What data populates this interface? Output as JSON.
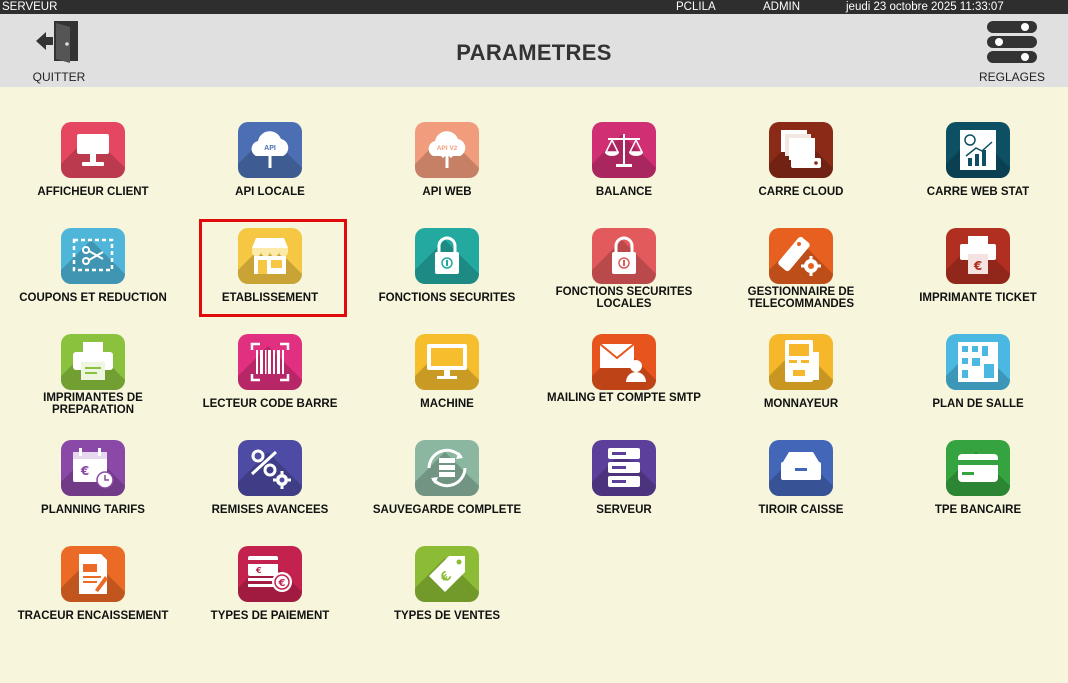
{
  "statusbar": {
    "left": "SERVEUR",
    "computer": "PCLILA",
    "user": "ADMIN",
    "datetime": "jeudi 23 octobre 2025   11:33:07"
  },
  "header": {
    "title": "PARAMETRES",
    "quit_label": "QUITTER",
    "settings_label": "REGLAGES"
  },
  "selected_item": "ETABLISSEMENT",
  "tiles": [
    {
      "label": "AFFICHEUR CLIENT",
      "color": "#e4475f",
      "icon": "customer-display-icon"
    },
    {
      "label": "API LOCALE",
      "color": "#4c6fb3",
      "icon": "cloud-upload-icon",
      "badge": "API"
    },
    {
      "label": "API WEB",
      "color": "#f19d7d",
      "icon": "cloud-upload-icon",
      "badge": "API V2"
    },
    {
      "label": "BALANCE",
      "color": "#d02f73",
      "icon": "scale-icon"
    },
    {
      "label": "CARRE CLOUD",
      "color": "#8a2a17",
      "icon": "server-stack-icon"
    },
    {
      "label": "CARRE WEB STAT",
      "color": "#0d4f63",
      "icon": "web-stat-icon"
    },
    {
      "label": "COUPONS ET REDUCTION",
      "color": "#4fb6da",
      "icon": "coupon-scissors-icon"
    },
    {
      "label": "ETABLISSEMENT",
      "color": "#f6c742",
      "icon": "shop-icon"
    },
    {
      "label": "FONCTIONS SECURITES",
      "color": "#24a9a0",
      "icon": "padlock-icon"
    },
    {
      "label": "FONCTIONS SECURITES LOCALES",
      "color": "#e35a5d",
      "icon": "padlock-icon"
    },
    {
      "label": "GESTIONNAIRE DE TELECOMMANDES",
      "color": "#e8601f",
      "icon": "remote-control-icon"
    },
    {
      "label": "IMPRIMANTE TICKET",
      "color": "#b12f20",
      "icon": "ticket-printer-icon"
    },
    {
      "label": "IMPRIMANTES DE PREPARATION",
      "color": "#8ac23e",
      "icon": "printer-icon"
    },
    {
      "label": "LECTEUR CODE BARRE",
      "color": "#e0307f",
      "icon": "barcode-icon"
    },
    {
      "label": "MACHINE",
      "color": "#f6be2d",
      "icon": "monitor-icon"
    },
    {
      "label": "MAILING ET COMPTE SMTP",
      "color": "#e8541e",
      "icon": "mail-user-icon"
    },
    {
      "label": "MONNAYEUR",
      "color": "#f6b72a",
      "icon": "cash-machine-icon"
    },
    {
      "label": "PLAN DE SALLE",
      "color": "#4ab8e0",
      "icon": "floor-plan-icon"
    },
    {
      "label": "PLANNING TARIFS",
      "color": "#8a49a6",
      "icon": "calendar-euro-icon"
    },
    {
      "label": "REMISES AVANCEES",
      "color": "#4d4ba4",
      "icon": "percent-gear-icon"
    },
    {
      "label": "SAUVEGARDE COMPLETE",
      "color": "#8bb6a0",
      "icon": "backup-icon"
    },
    {
      "label": "SERVEUR",
      "color": "#5c3f9a",
      "icon": "server-icon"
    },
    {
      "label": "TIROIR CAISSE",
      "color": "#4466b8",
      "icon": "cash-drawer-icon"
    },
    {
      "label": "TPE BANCAIRE",
      "color": "#35a33f",
      "icon": "card-icon"
    },
    {
      "label": "TRACEUR ENCAISSEMENT",
      "color": "#eb6a25",
      "icon": "receipt-tracker-icon"
    },
    {
      "label": "TYPES DE PAIEMENT",
      "color": "#c4224e",
      "icon": "payment-types-icon"
    },
    {
      "label": "TYPES DE VENTES",
      "color": "#8cbc35",
      "icon": "price-tag-icon"
    }
  ]
}
